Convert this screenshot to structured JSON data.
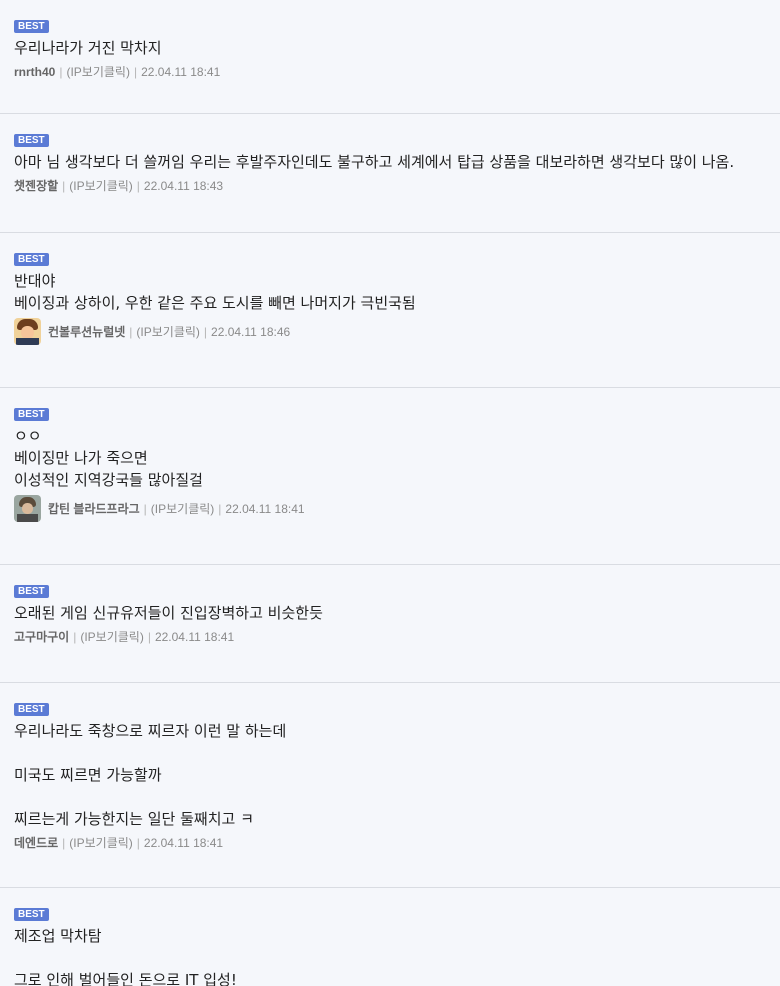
{
  "badge_label": "BEST",
  "ip_label": "(IP보기클릭)",
  "separator": "|",
  "comments": [
    {
      "lines": [
        "우리나라가 거진 막차지"
      ],
      "nick": "rnrth40",
      "datetime": "22.04.11 18:41",
      "has_avatar": false
    },
    {
      "lines": [
        "아마 님 생각보다 더 쓸꺼임 우리는 후발주자인데도 불구하고 세계에서 탑급 상품을 대보라하면 생각보다 많이 나옴."
      ],
      "nick": "챗젠장할",
      "datetime": "22.04.11 18:43",
      "has_avatar": false
    },
    {
      "lines": [
        "반대야",
        "베이징과 상하이, 우한 같은 주요 도시를 빼면 나머지가 극빈국됨"
      ],
      "nick": "컨볼루션뉴럴넷",
      "datetime": "22.04.11 18:46",
      "has_avatar": true,
      "avatar_icon": "anime-character-avatar-icon"
    },
    {
      "lines": [
        "ㅇㅇ",
        "베이징만 나가 죽으면",
        "이성적인 지역강국들 많아질걸"
      ],
      "nick": "캅틴 블라드프라그",
      "datetime": "22.04.11 18:41",
      "has_avatar": true,
      "avatar_icon": "character-portrait-avatar-icon"
    },
    {
      "lines": [
        "오래된 게임 신규유저들이 진입장벽하고 비슷한듯"
      ],
      "nick": "고구마구이",
      "datetime": "22.04.11 18:41",
      "has_avatar": false
    },
    {
      "lines": [
        "우리나라도 죽창으로 찌르자 이런 말 하는데",
        "",
        "미국도 찌르면 가능할까",
        "",
        "찌르는게 가능한지는 일단 둘째치고 ㅋ"
      ],
      "nick": "데엔드로",
      "datetime": "22.04.11 18:41",
      "has_avatar": false
    },
    {
      "lines": [
        "제조업 막차탐",
        "",
        "그로 인해 벌어들인 돈으로 IT 입성!"
      ],
      "nick": "",
      "datetime": "",
      "has_avatar": false
    }
  ]
}
